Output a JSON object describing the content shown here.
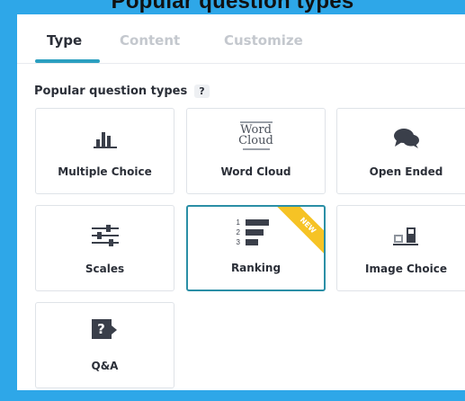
{
  "page": {
    "heading": "Popular question types"
  },
  "tabs": [
    {
      "label": "Type",
      "active": true
    },
    {
      "label": "Content",
      "active": false
    },
    {
      "label": "Customize",
      "active": false
    }
  ],
  "section": {
    "title": "Popular question types",
    "help": "?"
  },
  "cards": [
    {
      "label": "Multiple Choice",
      "icon": "bar-chart-icon"
    },
    {
      "label": "Word Cloud",
      "icon": "word-cloud-icon",
      "icon_text": "Word Cloud"
    },
    {
      "label": "Open Ended",
      "icon": "speech-bubbles-icon"
    },
    {
      "label": "Scales",
      "icon": "sliders-icon"
    },
    {
      "label": "Ranking",
      "icon": "ranking-icon",
      "selected": true,
      "badge": "NEW",
      "ranks": [
        "1",
        "2",
        "3"
      ]
    },
    {
      "label": "Image Choice",
      "icon": "image-choice-icon"
    },
    {
      "label": "Q&A",
      "icon": "question-box-icon",
      "icon_text": "?"
    }
  ],
  "colors": {
    "background": "#2ea7e8",
    "accent": "#2b9fc0",
    "badge": "#f6c325",
    "icon": "#3a3f4a"
  }
}
